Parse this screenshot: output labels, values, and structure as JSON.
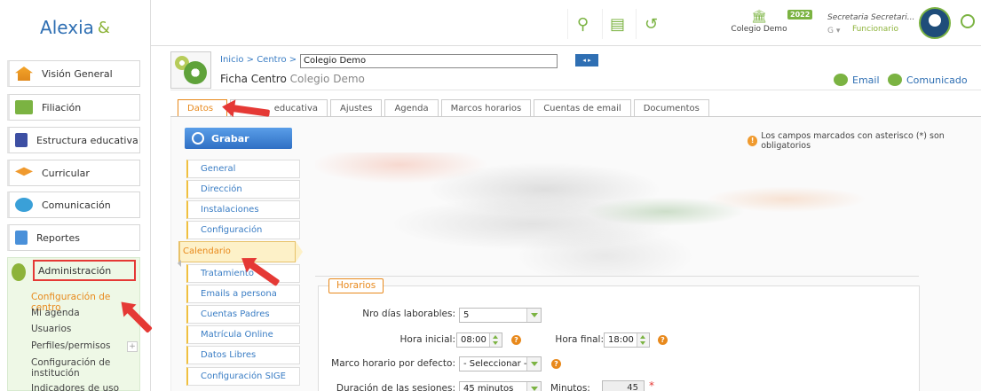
{
  "app": {
    "logo_text": "Alexia",
    "logo_mark": "&"
  },
  "sidebar": {
    "items": [
      {
        "label": "Visión General",
        "icon": "home-icon"
      },
      {
        "label": "Filiación",
        "icon": "id-card-icon"
      },
      {
        "label": "Estructura educativa",
        "icon": "book-icon"
      },
      {
        "label": "Curricular",
        "icon": "graduation-cap-icon"
      },
      {
        "label": "Comunicación",
        "icon": "chat-bubbles-icon"
      },
      {
        "label": "Reportes",
        "icon": "report-icon"
      }
    ],
    "admin": {
      "label": "Administración",
      "sub": [
        "Configuración de centro",
        "Mi agenda",
        "Usuarios",
        "Perfiles/permisos",
        "Configuración de institución",
        "Indicadores de uso"
      ],
      "plus": "+"
    }
  },
  "topbar": {
    "year": "2022",
    "colegio": "Colegio Demo",
    "user_name": "Secretaria Secretari...",
    "user_role": "Funcionario",
    "user_g": "G ▾"
  },
  "header": {
    "breadcrumb": "Inicio > Centro >",
    "centro_value": "Colegio Demo",
    "nav": "◂ ▸",
    "ficha_title": "Ficha Centro",
    "ficha_sub": "Colegio Demo",
    "email_label": "Email",
    "comunicado_label": "Comunicado"
  },
  "tabs": [
    "Datos",
    "educativa",
    "Ajustes",
    "Agenda",
    "Marcos horarios",
    "Cuentas de email",
    "Documentos"
  ],
  "main": {
    "grabar": "Grabar",
    "required_note": "Los campos marcados con asterisco (*) son obligatorios",
    "warn": "!",
    "subnav": [
      "General",
      "Dirección",
      "Instalaciones",
      "Configuración",
      "Calendario",
      "Tratamiento",
      "Emails a persona",
      "Cuentas Padres",
      "Matrícula Online",
      "Datos Libres",
      "Configuración SIGE"
    ],
    "horarios": {
      "legend": "Horarios",
      "dias_label": "Nro días laborables:",
      "dias_value": "5",
      "hora_inicial_label": "Hora inicial:",
      "hora_inicial_value": "08:00",
      "hora_final_label": "Hora final:",
      "hora_final_value": "18:00",
      "marco_label": "Marco horario por defecto:",
      "marco_value": "- Seleccionar -",
      "duracion_label": "Duración de las sesiones:",
      "duracion_value": "45 minutos",
      "minutos_label": "Minutos:",
      "minutos_value": "45",
      "required_mark": "*",
      "help": "?"
    }
  },
  "colors": {
    "accent_green": "#7bb342",
    "accent_orange": "#e8891c",
    "primary_blue": "#2f6fb3",
    "annotation_red": "#e53935"
  }
}
